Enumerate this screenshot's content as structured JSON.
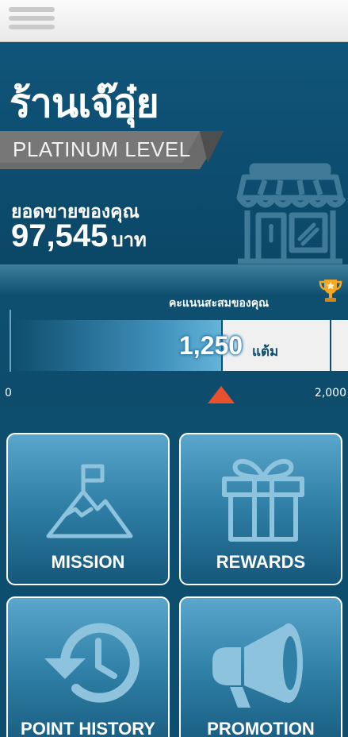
{
  "header": {
    "menu_icon": "hamburger-menu-icon"
  },
  "shop": {
    "name": "ร้านเจ๊อุ๋ย",
    "level": "PLATINUM LEVEL",
    "sales_label": "ยอดขายของคุณ",
    "sales_value": "97,545",
    "sales_unit": "บาท"
  },
  "points": {
    "label": "คะแนนสะสมของคุณ",
    "value": "1,250",
    "value_number": 1250,
    "unit": "แต้ม",
    "min_label": "0",
    "max_label": "2,000",
    "max_number": 2000,
    "trophy_icon": "trophy-icon"
  },
  "menu": [
    {
      "label": "MISSION",
      "icon": "mountain-flag-icon"
    },
    {
      "label": "REWARDS",
      "icon": "gift-icon"
    },
    {
      "label": "POINT HISTORY",
      "icon": "history-clock-icon"
    },
    {
      "label": "PROMOTION",
      "icon": "megaphone-icon"
    }
  ],
  "colors": {
    "primary": "#0d4d6e",
    "accent": "#e8512c",
    "tile": "#2f7fa6",
    "trophy": "#f5a623"
  }
}
